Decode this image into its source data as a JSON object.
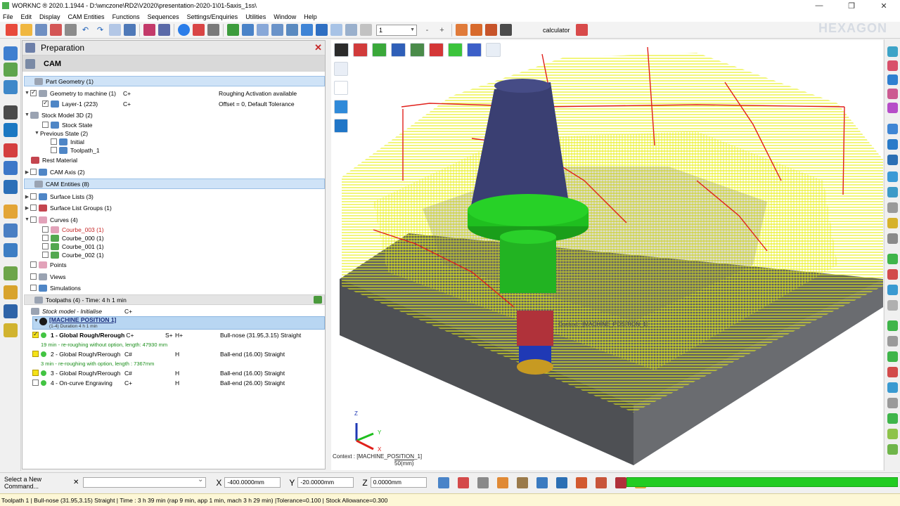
{
  "window": {
    "title": "WORKNC ® 2020.1.1944 - D:\\wnczone\\RD2\\V2020\\presentation-2020-1\\01-5axis_1ss\\",
    "minimize": "—",
    "maximize": "❐",
    "close": "✕"
  },
  "menu": [
    "File",
    "Edit",
    "Display",
    "CAM Entities",
    "Functions",
    "Sequences",
    "Settings/Enquiries",
    "Utilities",
    "Window",
    "Help"
  ],
  "toolbar": {
    "combo_value": "1",
    "calculator_label": "calculator",
    "brand": "HEXAGON"
  },
  "panel": {
    "title": "Preparation",
    "close": "✕",
    "sub_title": "CAM"
  },
  "tree": {
    "part_geometry": "Part Geometry (1)",
    "geom_to_machine": "Geometry to machine (1)",
    "geom_to_machine_flag": "C+",
    "geom_to_machine_info": "Roughing Activation available",
    "layer": "Layer-1 (223)",
    "layer_flag": "C+",
    "layer_info": "Offset = 0, Default Tolerance",
    "stock_model": "Stock Model 3D (2)",
    "stock_state": "Stock State",
    "previous_state": "Previous State (2)",
    "initial": "Initial",
    "toolpath_1": "Toolpath_1",
    "rest_material": "Rest Material",
    "cam_axis": "CAM Axis (2)",
    "cam_entities": "CAM Entities (8)",
    "surface_lists": "Surface Lists (3)",
    "surface_list_groups": "Surface List Groups (1)",
    "curves": "Curves (4)",
    "courbe_003": "Courbe_003 (1)",
    "courbe_000": "Courbe_000 (1)",
    "courbe_001": "Courbe_001 (1)",
    "courbe_002": "Courbe_002 (1)",
    "points": "Points",
    "views": "Views",
    "simulations": "Simulations",
    "toolpaths": "Toolpaths (4) - Time: 4 h 1 min",
    "stock_init": "Stock model - Initialise",
    "stock_init_flag": "C+",
    "machine_position": "[MACHINE POSITION 1]",
    "machine_position_sub": "(1-4) Duration 4 h 1 min",
    "tp1": "1 - Global Rough/Rerough",
    "tp1_flag": "C+",
    "tp1_sp": "S+",
    "tp1_h": "H+",
    "tp1_tool": "Bull-nose (31.95,3.15) Straight",
    "tp1_note": "19 min - re-roughing without option, length: 47930 mm",
    "tp2": "2 - Global Rough/Rerough",
    "tp2_flag": "C#",
    "tp2_h": "H",
    "tp2_tool": "Ball-end (16.00) Straight",
    "tp2_note": "3 min - re-roughing with option, length : 7367mm",
    "tp3": "3 - Global Rough/Rerough",
    "tp3_flag": "C#",
    "tp3_h": "H",
    "tp3_tool": "Ball-end (16.00) Straight",
    "tp4": "4 - On-curve Engraving",
    "tp4_flag": "C+",
    "tp4_h": "H",
    "tp4_tool": "Ball-end (26.00) Straight"
  },
  "viewport": {
    "context_tool": "Context : [MACHINE_POSITION_1]",
    "context_bottom": "Context : [MACHINE_POSITION_1]",
    "scale": "50(mm)",
    "triad": {
      "z": "Z",
      "y": "Y",
      "x": "X"
    }
  },
  "command": {
    "label": "Select a New Command...",
    "clear": "✕",
    "x_label": "X",
    "x_value": "-400.0000mm",
    "y_label": "Y",
    "y_value": "-20.0000mm",
    "z_label": "Z",
    "z_value": "0.0000mm",
    "progress": 1.0
  },
  "status": "Toolpath 1 | Bull-nose (31.95,3.15) Straight | Time : 3 h 39 min (rap 9 min, app 1 min, mach 3 h 29 min) |Tolerance=0.100 | Stock Allowance=0.300",
  "colors": {
    "accent": "#22cc22",
    "tool_holder": "#3a3f72",
    "tool_green": "#1fbf1f",
    "toolpath_yellow": "#e7ef17",
    "toolpath_red": "#e0201b",
    "stock_gray": "#5e6064"
  }
}
